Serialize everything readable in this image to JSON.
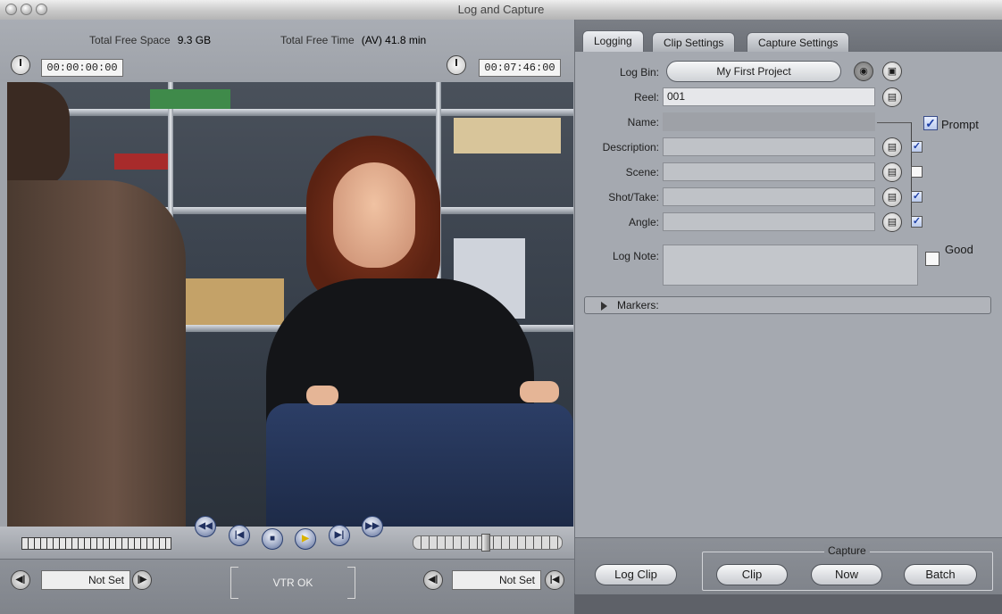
{
  "window": {
    "title": "Log and Capture"
  },
  "viewer": {
    "free_space_label": "Total Free Space",
    "free_space_value": "9.3 GB",
    "free_time_label": "Total Free Time",
    "free_time_value": "(AV) 41.8 min",
    "in_timecode": "00:00:00:00",
    "duration_timecode": "00:07:46:00"
  },
  "deck": {
    "in_point": "Not Set",
    "out_point": "Not Set",
    "status": "VTR OK"
  },
  "tabs": [
    "Logging",
    "Clip Settings",
    "Capture Settings"
  ],
  "logging": {
    "log_bin_label": "Log Bin:",
    "log_bin_value": "My First Project",
    "reel_label": "Reel:",
    "reel_value": "001",
    "name_label": "Name:",
    "name_value": "",
    "prompt_label": "Prompt",
    "prompt_checked": true,
    "description_label": "Description:",
    "description_value": "",
    "description_checked": true,
    "scene_label": "Scene:",
    "scene_value": "",
    "scene_checked": false,
    "shot_label": "Shot/Take:",
    "shot_value": "",
    "shot_checked": true,
    "angle_label": "Angle:",
    "angle_value": "",
    "angle_checked": true,
    "log_note_label": "Log Note:",
    "log_note_value": "",
    "good_label": "Good",
    "good_checked": false,
    "markers_label": "Markers:"
  },
  "actions": {
    "log_clip": "Log Clip",
    "capture_label": "Capture",
    "clip": "Clip",
    "now": "Now",
    "batch": "Batch"
  },
  "colors": {
    "accent": "#1d3fa6",
    "panel": "#a5a9b0"
  }
}
